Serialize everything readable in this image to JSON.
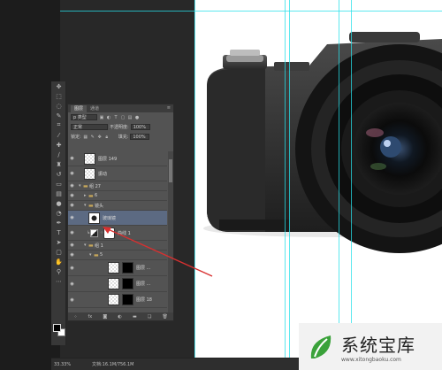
{
  "panel": {
    "tabs": [
      "图层",
      "通道",
      "路径"
    ],
    "filter_kind": "p 类型",
    "blend_mode": "正常",
    "opacity_label": "不透明度:",
    "opacity_value": "100%",
    "lock_label": "锁定:",
    "fill_label": "填充:",
    "fill_value": "100%",
    "layers": [
      {
        "kind": "layer",
        "name": "图层 149",
        "indent": 0
      },
      {
        "kind": "layer",
        "name": "振动",
        "indent": 0
      },
      {
        "kind": "group",
        "name": "组 27",
        "indent": 0,
        "expanded": true
      },
      {
        "kind": "group",
        "name": "6",
        "indent": 1,
        "expanded": false
      },
      {
        "kind": "group",
        "name": "镜头",
        "indent": 1,
        "expanded": true
      },
      {
        "kind": "layer",
        "name": "玻璃镜",
        "indent": 2,
        "selected": true
      },
      {
        "kind": "adjustment",
        "name": "曲线 1",
        "indent": 2
      },
      {
        "kind": "group",
        "name": "组 1",
        "indent": 1,
        "expanded": true
      },
      {
        "kind": "group",
        "name": "5",
        "indent": 2,
        "expanded": true
      },
      {
        "kind": "masked",
        "name": "图层 ...",
        "indent": 3
      },
      {
        "kind": "masked",
        "name": "图层 ...",
        "indent": 3
      },
      {
        "kind": "masked",
        "name": "图层 18",
        "indent": 3
      }
    ],
    "footer_icons": [
      "link-icon",
      "fx-icon",
      "mask-icon",
      "adjustment-icon",
      "folder-icon",
      "new-layer-icon",
      "trash-icon"
    ]
  },
  "status": {
    "zoom": "33.33%",
    "doc": "文档:16.1M/756.1M"
  },
  "watermark": {
    "title": "系统宝库",
    "url": "www.xitongbaoku.com",
    "logo_color": "#3aa23a"
  },
  "colors": {
    "guide": "#27e0ea",
    "selected_layer": "#5c6a82",
    "annotation_arrow": "#d83030"
  }
}
